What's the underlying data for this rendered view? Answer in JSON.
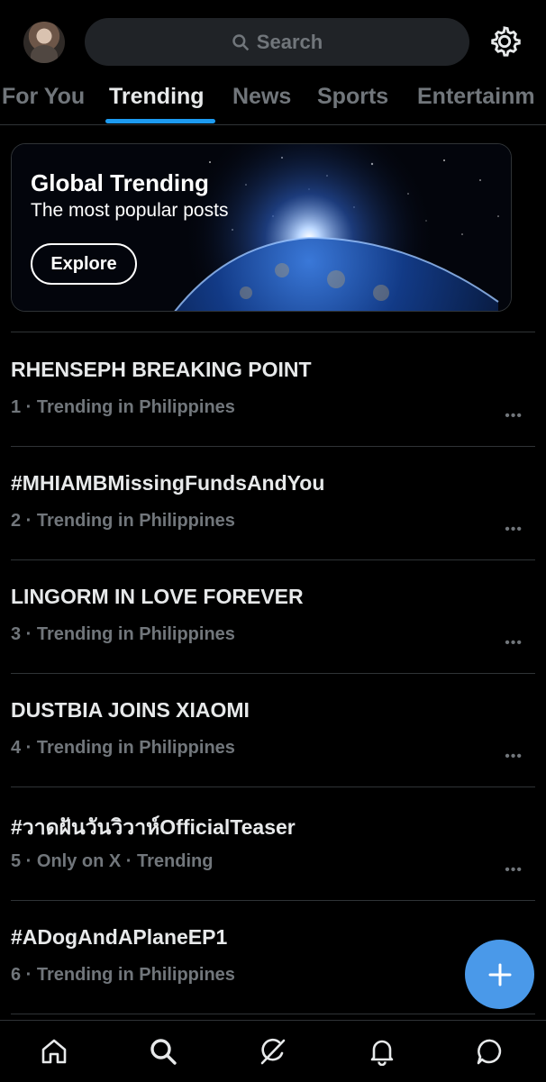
{
  "header": {
    "search_placeholder": "Search",
    "avatar_icon": "profile-avatar",
    "settings_icon": "gear-icon"
  },
  "tabs": [
    {
      "label": "For You",
      "active": false
    },
    {
      "label": "Trending",
      "active": true
    },
    {
      "label": "News",
      "active": false
    },
    {
      "label": "Sports",
      "active": false
    },
    {
      "label": "Entertainm",
      "active": false
    }
  ],
  "banner": {
    "title": "Global Trending",
    "subtitle": "The most popular posts",
    "button_label": "Explore"
  },
  "trends": [
    {
      "title": "RHENSEPH BREAKING POINT",
      "meta": "1 · Trending in Philippines"
    },
    {
      "title": "#MHIAMBMissingFundsAndYou",
      "meta": "2 · Trending in Philippines"
    },
    {
      "title": "LINGORM IN LOVE FOREVER",
      "meta": "3 · Trending in Philippines"
    },
    {
      "title": "DUSTBIA JOINS XIAOMI",
      "meta": "4 · Trending in Philippines"
    },
    {
      "title": "#วาดฝันวันวิวาห์OfficialTeaser",
      "meta": "5 · Only on X · Trending"
    },
    {
      "title": "#ADogAndAPlaneEP1",
      "meta": "6 · Trending in Philippines"
    }
  ],
  "more_label": "•••",
  "fab": {
    "icon": "plus-icon"
  },
  "bottom_nav": [
    {
      "icon": "home-icon"
    },
    {
      "icon": "search-icon"
    },
    {
      "icon": "grok-icon"
    },
    {
      "icon": "bell-icon"
    },
    {
      "icon": "messages-icon"
    }
  ],
  "colors": {
    "accent": "#1d9bf0",
    "fab": "#4a99e9",
    "background": "#000000",
    "muted_text": "#71767b"
  }
}
